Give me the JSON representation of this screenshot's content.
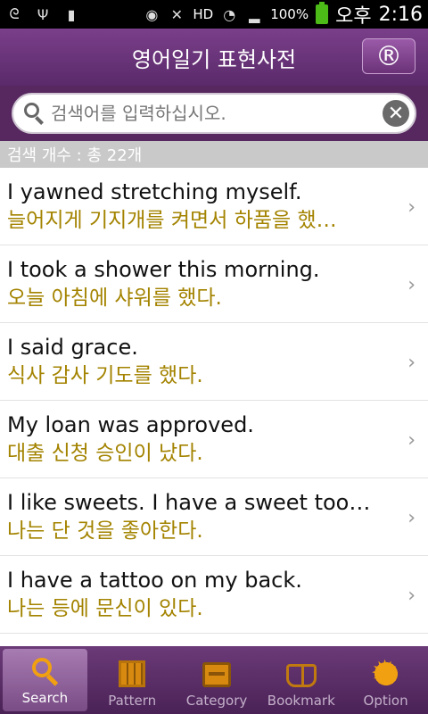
{
  "status_bar": {
    "battery_percent": "100%",
    "ampm": "오후",
    "time": "2:16",
    "hd": "HD"
  },
  "header": {
    "title": "영어일기 표현사전",
    "reg_button": "®"
  },
  "search": {
    "placeholder": "검색어를 입력하십시오.",
    "clear_symbol": "✕"
  },
  "results": {
    "count_text": "검색 개수 : 총 22개"
  },
  "items": [
    {
      "en": "I yawned stretching myself.",
      "ko": "늘어지게 기지개를 켜면서 하품을 했…"
    },
    {
      "en": "I took a shower this morning.",
      "ko": "오늘 아침에 샤워를 했다."
    },
    {
      "en": "I said grace.",
      "ko": "식사 감사 기도를 했다."
    },
    {
      "en": "My loan was approved.",
      "ko": "대출 신청 승인이 났다."
    },
    {
      "en": "I like sweets. I have a sweet too…",
      "ko": "나는 단 것을 좋아한다."
    },
    {
      "en": "I have a tattoo on my back.",
      "ko": "나는 등에 문신이 있다."
    }
  ],
  "tabs": [
    {
      "label": "Search",
      "icon": "search-icon",
      "active": true
    },
    {
      "label": "Pattern",
      "icon": "pattern-icon",
      "active": false
    },
    {
      "label": "Category",
      "icon": "category-icon",
      "active": false
    },
    {
      "label": "Bookmark",
      "icon": "bookmark-icon",
      "active": false
    },
    {
      "label": "Option",
      "icon": "gear-icon",
      "active": false
    }
  ],
  "colors": {
    "header_purple": "#5a2a6a",
    "korean_text": "#a38300",
    "tab_icon": "#f0a010"
  }
}
